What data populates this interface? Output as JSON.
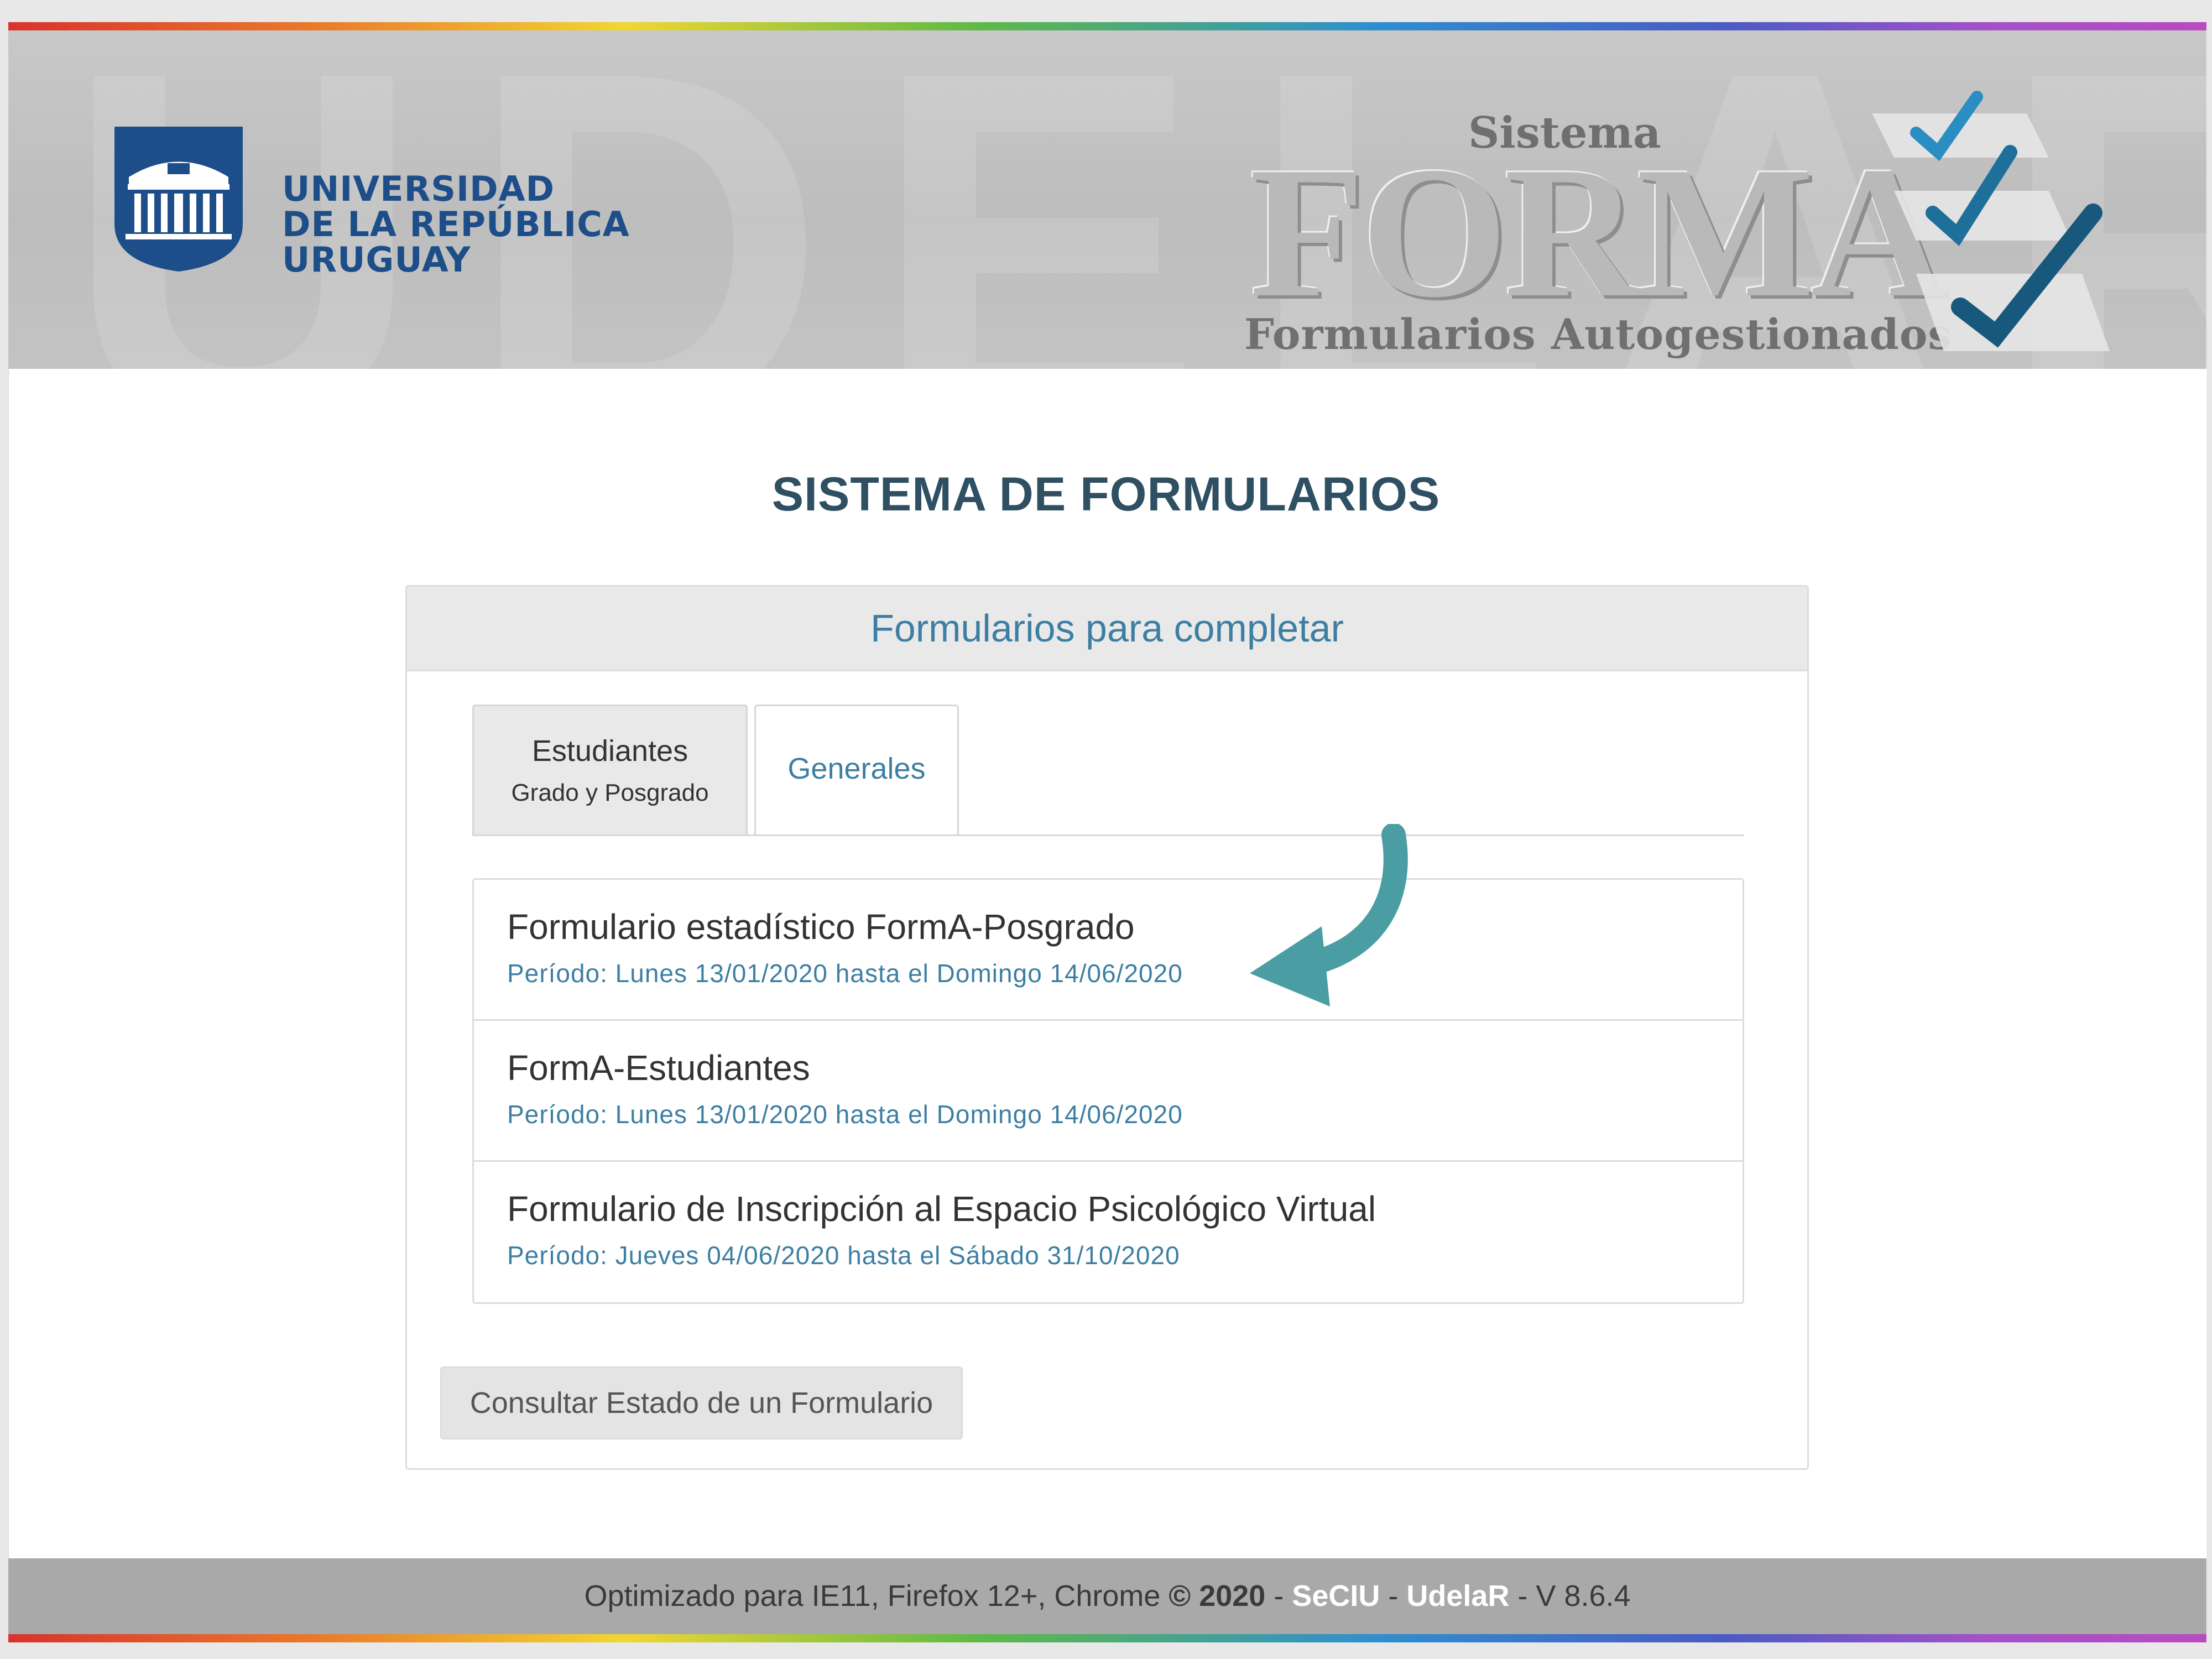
{
  "header": {
    "watermark": "UDELAR",
    "university": {
      "line1": "UNIVERSIDAD",
      "line2": "DE LA REPÚBLICA",
      "line3": "URUGUAY"
    },
    "brand": {
      "top": "Sistema",
      "word": "FORMA",
      "subtitle": "Formularios Autogestionados"
    }
  },
  "page_title": "SISTEMA DE FORMULARIOS",
  "panel": {
    "heading": "Formularios para completar",
    "tabs": [
      {
        "label": "Estudiantes",
        "sublabel": "Grado y Posgrado",
        "active": true
      },
      {
        "label": "Generales",
        "active": false
      }
    ],
    "forms": [
      {
        "title": "Formulario estadístico FormA-Posgrado",
        "period": "Período: Lunes 13/01/2020 hasta el Domingo 14/06/2020"
      },
      {
        "title": "FormA-Estudiantes",
        "period": "Período: Lunes 13/01/2020 hasta el Domingo 14/06/2020"
      },
      {
        "title": "Formulario de Inscripción al Espacio Psicológico Virtual",
        "period": "Período: Jueves 04/06/2020 hasta el Sábado 31/10/2020"
      }
    ],
    "status_button": "Consultar Estado de un Formulario"
  },
  "footer": {
    "prefix": "Optimizado para IE11, Firefox 12+, Chrome ",
    "copyright": "© 2020",
    "sep1": " - ",
    "link1": "SeCIU",
    "sep2": " - ",
    "link2": "UdelaR",
    "version": " - V 8.6.4"
  },
  "colors": {
    "accent": "#3d7fa3",
    "title": "#2f4f62",
    "arrow": "#4a9ea3",
    "university_blue": "#1d4e89"
  },
  "icons": {
    "logo": "university-shield-icon",
    "checks": "checkmark-icon",
    "arrow": "curved-arrow-icon"
  }
}
